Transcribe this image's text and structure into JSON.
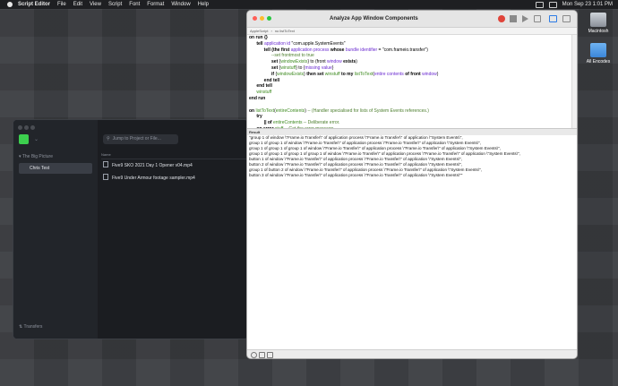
{
  "menubar": {
    "app": "Script Editor",
    "items": [
      "File",
      "Edit",
      "View",
      "Script",
      "Font",
      "Format",
      "Window",
      "Help"
    ],
    "datetime": "Mon Sep 23  1:01 PM"
  },
  "desktop": {
    "icons": [
      {
        "label": "Macintosh",
        "icon": "hard-drive-icon"
      },
      {
        "label": "All Encodes",
        "icon": "folder-icon"
      }
    ]
  },
  "frameio": {
    "projects_label": "The Big Picture",
    "selected_project": "Chris Test",
    "search_placeholder": "Jump to Project or File...",
    "column_name": "Name",
    "files": [
      "Five9 SKO 2021 Day 1 Opener v04.mp4",
      "Five9 Under Armour footage sampler.mp4"
    ],
    "transfers_label": "Transfers",
    "logo_color": "#3ccf4e"
  },
  "script_editor": {
    "title": "Analyze App Window Components",
    "breadcrumb": [
      "AppleScript",
      "no listToText"
    ],
    "result_label": "Result",
    "code_lines": [
      [
        {
          "t": "on run {}",
          "c": "kw"
        }
      ],
      [
        {
          "t": "      ",
          "c": ""
        },
        {
          "t": "tell ",
          "c": "kw"
        },
        {
          "t": "application ",
          "c": "pr"
        },
        {
          "t": "id ",
          "c": "pr"
        },
        {
          "t": "\"com.apple.SystemEvents\"",
          "c": "st"
        }
      ],
      [
        {
          "t": "            ",
          "c": ""
        },
        {
          "t": "tell ",
          "c": "kw"
        },
        {
          "t": "(the first ",
          "c": "kw"
        },
        {
          "t": "application process ",
          "c": "pr"
        },
        {
          "t": "whose ",
          "c": "kw"
        },
        {
          "t": "bundle identifier ",
          "c": "pr"
        },
        {
          "t": "= \"com.frameio.transfer\")",
          "c": "st"
        }
      ],
      [
        {
          "t": "                  ",
          "c": ""
        },
        {
          "t": "--set frontmost to true",
          "c": "cm"
        }
      ],
      [
        {
          "t": "                  ",
          "c": ""
        },
        {
          "t": "set ",
          "c": "kw"
        },
        {
          "t": "{",
          "c": "st"
        },
        {
          "t": "windowExists",
          "c": "vr"
        },
        {
          "t": "} to (front ",
          "c": "st"
        },
        {
          "t": "window ",
          "c": "pr"
        },
        {
          "t": "exists",
          "c": "kw"
        },
        {
          "t": ")",
          "c": "st"
        }
      ],
      [
        {
          "t": "                  ",
          "c": ""
        },
        {
          "t": "set ",
          "c": "kw"
        },
        {
          "t": "{",
          "c": "st"
        },
        {
          "t": "winstuff",
          "c": "vr"
        },
        {
          "t": "} to {",
          "c": "st"
        },
        {
          "t": "missing value",
          "c": "pr"
        },
        {
          "t": "}",
          "c": "st"
        }
      ],
      [
        {
          "t": "                  ",
          "c": ""
        },
        {
          "t": "if ",
          "c": "kw"
        },
        {
          "t": "{",
          "c": "st"
        },
        {
          "t": "windowExists",
          "c": "vr"
        },
        {
          "t": "} ",
          "c": "st"
        },
        {
          "t": "then set ",
          "c": "kw"
        },
        {
          "t": "winstuff ",
          "c": "vr"
        },
        {
          "t": "to my ",
          "c": "kw"
        },
        {
          "t": "listToText",
          "c": "vr"
        },
        {
          "t": "(",
          "c": "st"
        },
        {
          "t": "entire contents ",
          "c": "pr"
        },
        {
          "t": "of front ",
          "c": "kw"
        },
        {
          "t": "window",
          "c": "pr"
        },
        {
          "t": ")",
          "c": "st"
        }
      ],
      [
        {
          "t": "            ",
          "c": ""
        },
        {
          "t": "end tell",
          "c": "kw"
        }
      ],
      [
        {
          "t": "      ",
          "c": ""
        },
        {
          "t": "end tell",
          "c": "kw"
        }
      ],
      [
        {
          "t": "      ",
          "c": ""
        },
        {
          "t": "winstuff",
          "c": "vr"
        }
      ],
      [
        {
          "t": "end run",
          "c": "kw"
        }
      ],
      [
        {
          "t": " ",
          "c": ""
        }
      ],
      [
        {
          "t": "on ",
          "c": "kw"
        },
        {
          "t": "listToText",
          "c": "vr"
        },
        {
          "t": "(",
          "c": "st"
        },
        {
          "t": "entireContents",
          "c": "vr"
        },
        {
          "t": ") ",
          "c": "st"
        },
        {
          "t": "-- (Handler specialised for lists of System Events references.)",
          "c": "cm"
        }
      ],
      [
        {
          "t": "      ",
          "c": ""
        },
        {
          "t": "try",
          "c": "kw"
        }
      ],
      [
        {
          "t": "            ",
          "c": ""
        },
        {
          "t": "|| of ",
          "c": "kw"
        },
        {
          "t": "entireContents ",
          "c": "vr"
        },
        {
          "t": "-- Deliberate error.",
          "c": "cm"
        }
      ],
      [
        {
          "t": "      ",
          "c": ""
        },
        {
          "t": "on error ",
          "c": "kw"
        },
        {
          "t": "stuff ",
          "c": "vr"
        },
        {
          "t": "-- Get the error message",
          "c": "cm"
        }
      ],
      [
        {
          "t": "      ",
          "c": ""
        },
        {
          "t": "end try",
          "c": "kw"
        }
      ]
    ],
    "result_lines": [
      "\"group 1 of window \\\"Frame.io Transfer\\\" of application process \\\"Frame.io Transfer\\\" of application \\\"System Events\\\",",
      "group 1 of group 1 of window \\\"Frame.io Transfer\\\" of application process \\\"Frame.io Transfer\\\" of application \\\"System Events\\\",",
      "group 1 of group 1 of group 1 of window \\\"Frame.io Transfer\\\" of application process \\\"Frame.io Transfer\\\" of application \\\"System Events\\\",",
      "group 1 of group 1 of group 1 of group 1 of window \\\"Frame.io Transfer\\\" of application process \\\"Frame.io Transfer\\\" of application \\\"System Events\\\",",
      "button 1 of window \\\"Frame.io Transfer\\\" of application process \\\"Frame.io Transfer\\\" of application \\\"System Events\\\",",
      "button 2 of window \\\"Frame.io Transfer\\\" of application process \\\"Frame.io Transfer\\\" of application \\\"System Events\\\",",
      "group 1 of button 2 of window \\\"Frame.io Transfer\\\" of application process \\\"Frame.io Transfer\\\" of application \\\"System Events\\\",",
      "button 3 of window \\\"Frame.io Transfer\\\" of application process \\\"Frame.io Transfer\\\" of application \\\"System Events\\\"\""
    ]
  }
}
